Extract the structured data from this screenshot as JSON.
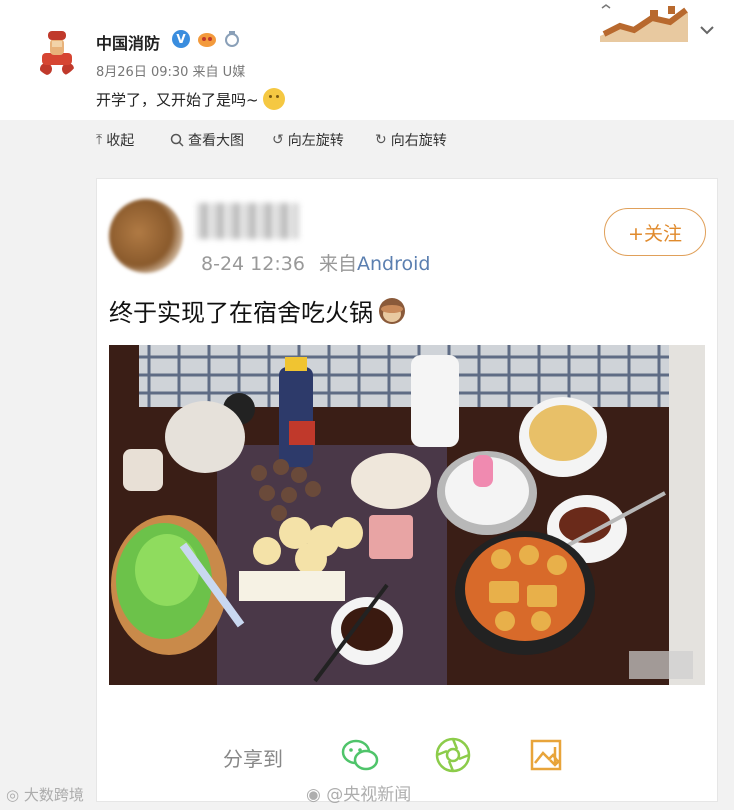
{
  "post": {
    "author": "中国消防",
    "verified_mark": "V",
    "meta": "8月26日 09:30 来自 U媒",
    "text": "开学了，又开始了是吗~"
  },
  "toolbar": {
    "collapse": "收起",
    "view_large": "查看大图",
    "rotate_left": "向左旋转",
    "rotate_right": "向右旋转"
  },
  "embedded": {
    "time": "8-24 12:36",
    "source_prefix": "来自",
    "source": "Android",
    "follow": "+关注",
    "text": "终于实现了在宿舍吃火锅",
    "share_label": "分享到"
  },
  "watermarks": {
    "left": "大数跨境",
    "center": "@央视新闻"
  },
  "colors": {
    "follow_orange": "#e08a2c",
    "share_green": "#4fc46a",
    "verified_blue": "#3a8dde"
  },
  "icons": [
    "chevron-down-icon",
    "collapse-icon",
    "search-icon",
    "rotate-left-icon",
    "rotate-right-icon",
    "wechat-icon",
    "moments-icon",
    "save-image-icon"
  ]
}
